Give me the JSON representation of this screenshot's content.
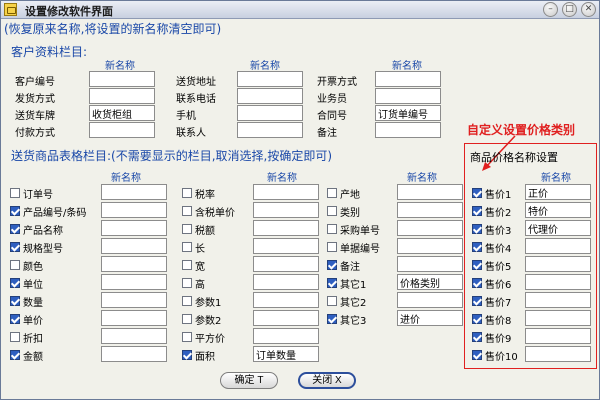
{
  "window": {
    "title": "设置修改软件界面"
  },
  "hint": "(恢复原来名称,将设置的新名称清空即可)",
  "customer": {
    "section": "客户资料栏目:",
    "header": "新名称",
    "cols": [
      [
        {
          "label": "客户编号",
          "value": ""
        },
        {
          "label": "发货方式",
          "value": ""
        },
        {
          "label": "送货车牌",
          "value": "收货柜组"
        },
        {
          "label": "付款方式",
          "value": ""
        }
      ],
      [
        {
          "label": "送货地址",
          "value": ""
        },
        {
          "label": "联系电话",
          "value": ""
        },
        {
          "label": "手机",
          "value": ""
        },
        {
          "label": "联系人",
          "value": ""
        }
      ],
      [
        {
          "label": "开票方式",
          "value": ""
        },
        {
          "label": "业务员",
          "value": ""
        },
        {
          "label": "合同号",
          "value": "订货单编号"
        },
        {
          "label": "备注",
          "value": ""
        }
      ]
    ]
  },
  "goods": {
    "section": "送货商品表格栏目:(不需要显示的栏目,取消选择,按确定即可)",
    "header": "新名称",
    "cols": [
      [
        {
          "label": "订单号",
          "checked": false,
          "value": ""
        },
        {
          "label": "产品编号/条码",
          "checked": true,
          "value": ""
        },
        {
          "label": "产品名称",
          "checked": true,
          "value": ""
        },
        {
          "label": "规格型号",
          "checked": true,
          "value": ""
        },
        {
          "label": "颜色",
          "checked": false,
          "value": ""
        },
        {
          "label": "单位",
          "checked": true,
          "value": ""
        },
        {
          "label": "数量",
          "checked": true,
          "value": ""
        },
        {
          "label": "单价",
          "checked": true,
          "value": ""
        },
        {
          "label": "折扣",
          "checked": false,
          "value": ""
        },
        {
          "label": "金额",
          "checked": true,
          "value": ""
        }
      ],
      [
        {
          "label": "税率",
          "checked": false,
          "value": ""
        },
        {
          "label": "含税单价",
          "checked": false,
          "value": ""
        },
        {
          "label": "税额",
          "checked": false,
          "value": ""
        },
        {
          "label": "长",
          "checked": false,
          "value": ""
        },
        {
          "label": "宽",
          "checked": false,
          "value": ""
        },
        {
          "label": "高",
          "checked": false,
          "value": ""
        },
        {
          "label": "参数1",
          "checked": false,
          "value": ""
        },
        {
          "label": "参数2",
          "checked": false,
          "value": ""
        },
        {
          "label": "平方价",
          "checked": false,
          "value": ""
        },
        {
          "label": "面积",
          "checked": true,
          "value": "订单数量"
        }
      ],
      [
        {
          "label": "产地",
          "checked": false,
          "value": ""
        },
        {
          "label": "类别",
          "checked": false,
          "value": ""
        },
        {
          "label": "采购单号",
          "checked": false,
          "value": ""
        },
        {
          "label": "单据编号",
          "checked": false,
          "value": ""
        },
        {
          "label": "备注",
          "checked": true,
          "value": ""
        },
        {
          "label": "其它1",
          "checked": true,
          "value": "价格类别"
        },
        {
          "label": "其它2",
          "checked": false,
          "value": ""
        },
        {
          "label": "其它3",
          "checked": true,
          "value": "进价"
        }
      ]
    ]
  },
  "price": {
    "callout": "自定义设置价格类别",
    "section": "商品价格名称设置",
    "header": "新名称",
    "items": [
      {
        "label": "售价1",
        "checked": true,
        "value": "正价"
      },
      {
        "label": "售价2",
        "checked": true,
        "value": "特价"
      },
      {
        "label": "售价3",
        "checked": true,
        "value": "代理价"
      },
      {
        "label": "售价4",
        "checked": true,
        "value": ""
      },
      {
        "label": "售价5",
        "checked": true,
        "value": ""
      },
      {
        "label": "售价6",
        "checked": true,
        "value": ""
      },
      {
        "label": "售价7",
        "checked": true,
        "value": ""
      },
      {
        "label": "售价8",
        "checked": true,
        "value": ""
      },
      {
        "label": "售价9",
        "checked": true,
        "value": ""
      },
      {
        "label": "售价10",
        "checked": true,
        "value": ""
      }
    ]
  },
  "buttons": {
    "ok": "确定 T",
    "close": "关闭 X"
  },
  "colors": {
    "accent": "#1a48a8",
    "callout": "#e02020",
    "checkbox": "#2f5fc0"
  }
}
